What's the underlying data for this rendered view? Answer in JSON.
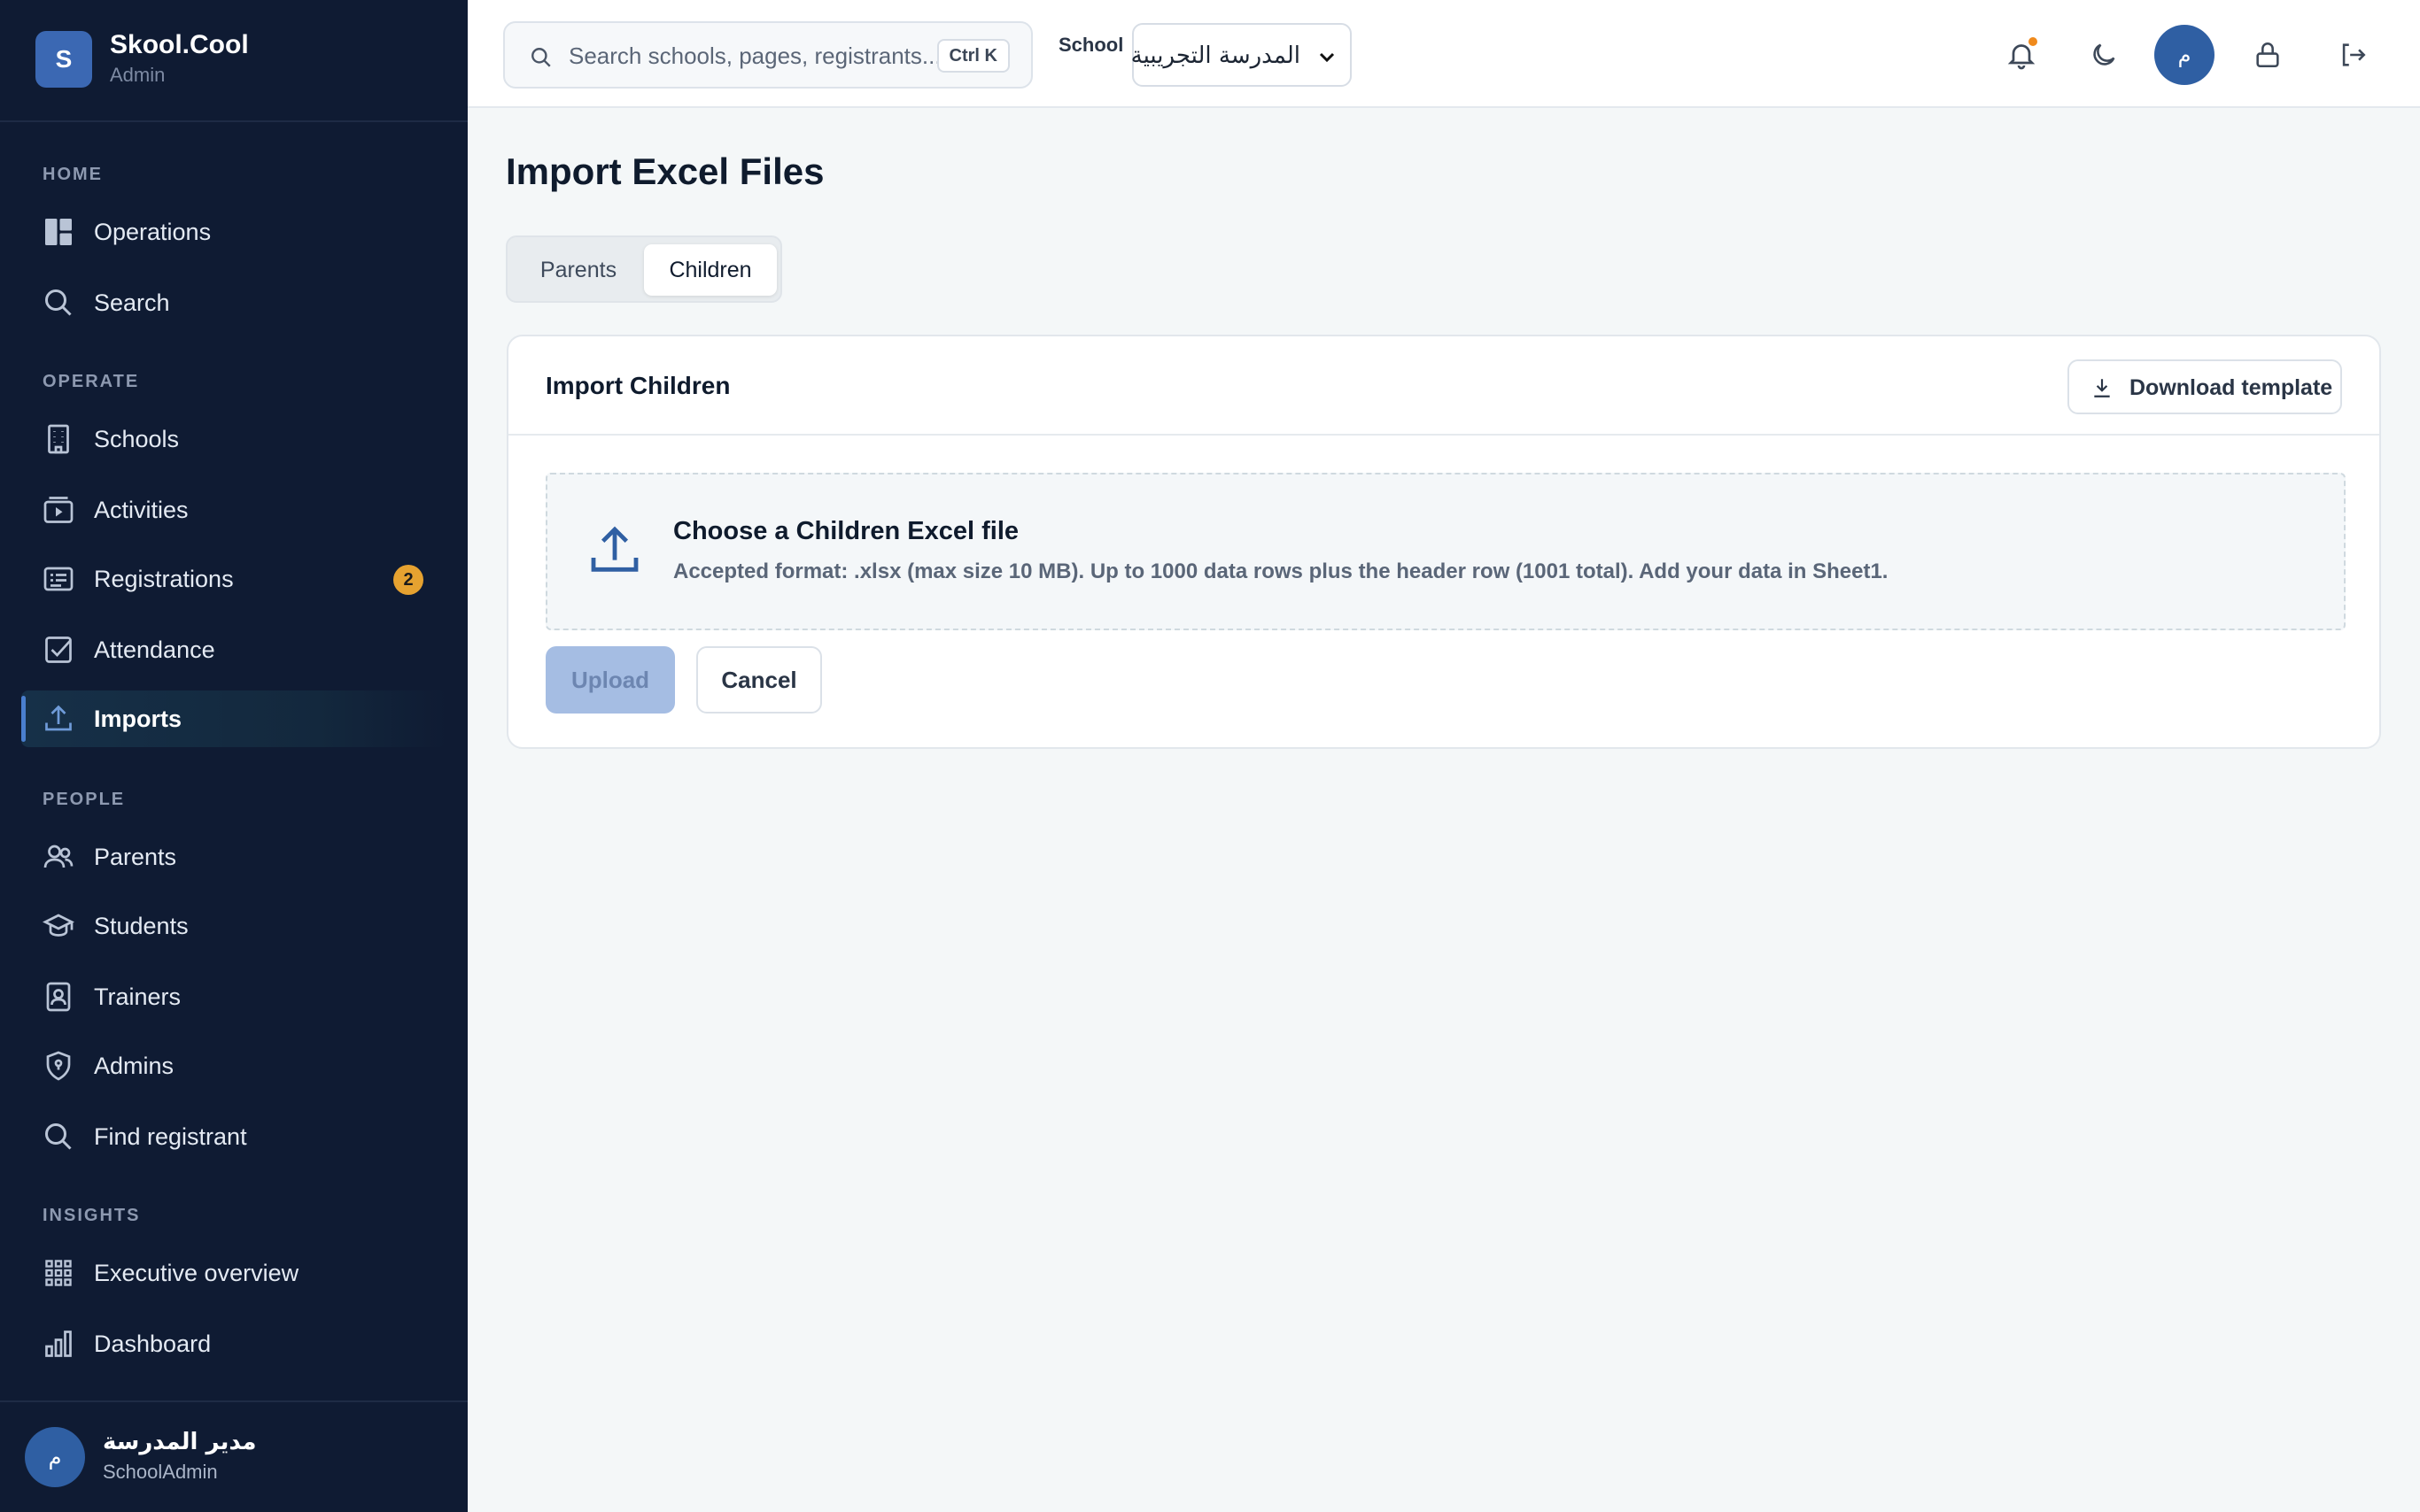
{
  "brand": {
    "logo_letter": "S",
    "name": "Skool.Cool",
    "role": "Admin"
  },
  "sidebar": {
    "sections": [
      {
        "label": "HOME"
      },
      {
        "label": "OPERATE"
      },
      {
        "label": "PEOPLE"
      },
      {
        "label": "INSIGHTS"
      }
    ],
    "items": [
      {
        "label": "Operations",
        "icon": "dashboard-grid-icon"
      },
      {
        "label": "Search",
        "icon": "search-icon"
      },
      {
        "label": "Schools",
        "icon": "building-icon"
      },
      {
        "label": "Activities",
        "icon": "video-play-icon"
      },
      {
        "label": "Registrations",
        "icon": "registration-card-icon",
        "badge": "2"
      },
      {
        "label": "Attendance",
        "icon": "checkbox-icon"
      },
      {
        "label": "Imports",
        "icon": "upload-icon",
        "active": true
      },
      {
        "label": "Parents",
        "icon": "users-icon"
      },
      {
        "label": "Students",
        "icon": "graduation-cap-icon"
      },
      {
        "label": "Trainers",
        "icon": "id-badge-icon"
      },
      {
        "label": "Admins",
        "icon": "shield-icon"
      },
      {
        "label": "Find registrant",
        "icon": "search-icon"
      },
      {
        "label": "Executive overview",
        "icon": "apps-grid-icon"
      },
      {
        "label": "Dashboard",
        "icon": "bar-chart-icon"
      }
    ],
    "user": {
      "initial": "م",
      "name": "مدير المدرسة",
      "role": "SchoolAdmin"
    }
  },
  "topbar": {
    "search": {
      "placeholder": "Search schools, pages, registrants...",
      "shortcut": "Ctrl K"
    },
    "school": {
      "label": "School",
      "value": "المدرسة التجريبية"
    },
    "avatar_initial": "م",
    "accent": "#2f5fa3",
    "notification_dot_color": "#f08a1c"
  },
  "main": {
    "title": "Import Excel Files",
    "tabs": [
      {
        "label": "Parents",
        "selected": false
      },
      {
        "label": "Children",
        "selected": true
      }
    ],
    "card": {
      "title": "Import Children",
      "download_label": "Download template",
      "dropzone": {
        "title": "Choose a Children Excel file",
        "help": "Accepted format: .xlsx (max size 10 MB). Up to 1000 data rows plus the header row (1001 total). Add your data in Sheet1."
      },
      "upload_label": "Upload",
      "cancel_label": "Cancel"
    }
  }
}
